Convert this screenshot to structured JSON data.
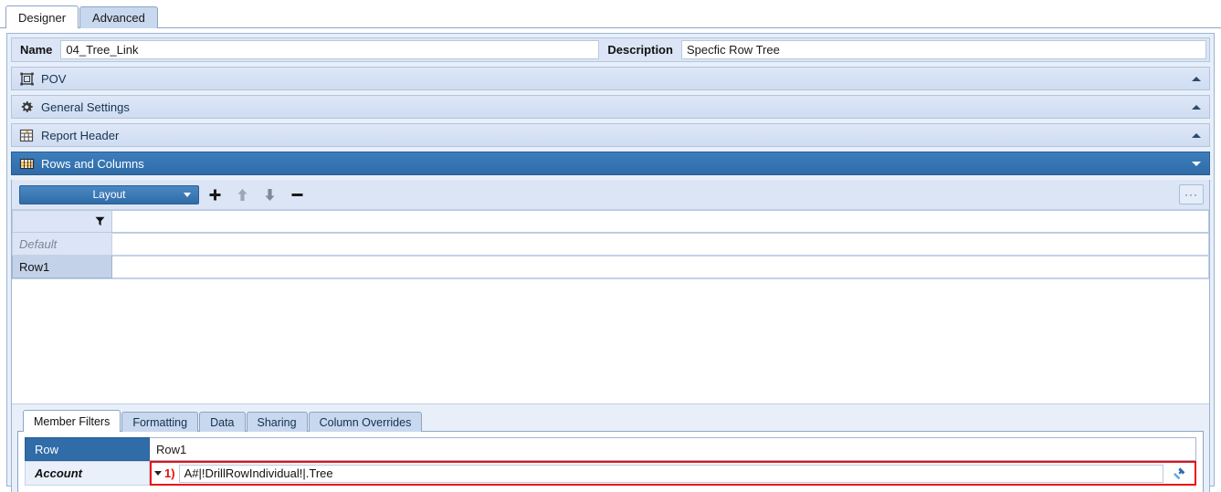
{
  "top_tabs": [
    {
      "label": "Designer",
      "active": true
    },
    {
      "label": "Advanced",
      "active": false
    }
  ],
  "header": {
    "name_label": "Name",
    "name_value": "04_Tree_Link",
    "description_label": "Description",
    "description_value": "Specfic Row Tree"
  },
  "sections": [
    {
      "title": "POV",
      "icon": "pov-icon",
      "expanded": false
    },
    {
      "title": "General Settings",
      "icon": "gear-icon",
      "expanded": false
    },
    {
      "title": "Report Header",
      "icon": "report-header-icon",
      "expanded": false
    },
    {
      "title": "Rows and Columns",
      "icon": "rows-columns-icon",
      "expanded": true
    }
  ],
  "toolbar": {
    "layout_label": "Layout",
    "add_label": "+",
    "move_up_label": "↑",
    "move_down_label": "↓",
    "remove_label": "−",
    "ellipsis_label": "···"
  },
  "grid": {
    "filter_icon": "filter-icon",
    "rows": [
      {
        "label": "Default",
        "style": "default"
      },
      {
        "label": "Row1",
        "style": "selected"
      }
    ]
  },
  "bottom_tabs": [
    {
      "label": "Member Filters",
      "active": true
    },
    {
      "label": "Formatting",
      "active": false
    },
    {
      "label": "Data",
      "active": false
    },
    {
      "label": "Sharing",
      "active": false
    },
    {
      "label": "Column Overrides",
      "active": false
    }
  ],
  "member_filters": {
    "row_label": "Row",
    "row_value": "Row1",
    "account_label": "Account",
    "marker": "1)",
    "formula": "A#|!DrillRowIndividual!|.Tree",
    "edit_icon": "hammer-icon"
  },
  "colors": {
    "accent_blue": "#2f6ca8",
    "panel_blue": "#dbe5f5",
    "highlight_red": "#e81010",
    "border_blue": "#9bb4d0"
  }
}
